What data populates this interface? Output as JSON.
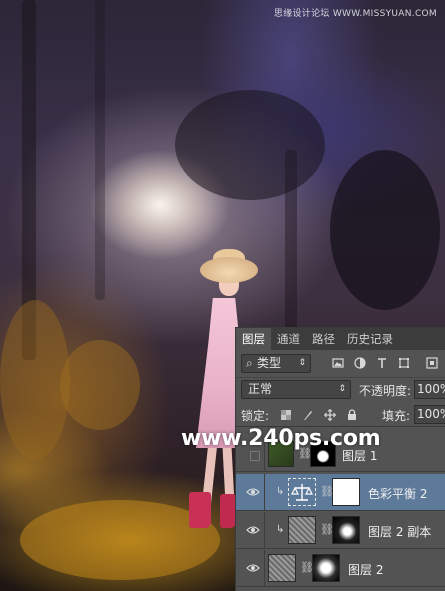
{
  "watermarks": {
    "top_right": "思缘设计论坛 WWW.MISSYUAN.COM",
    "center": "www.240ps.com"
  },
  "layers_panel": {
    "tabs": [
      {
        "label": "图层",
        "active": true
      },
      {
        "label": "通道",
        "active": false
      },
      {
        "label": "路径",
        "active": false
      },
      {
        "label": "历史记录",
        "active": false
      }
    ],
    "filter": {
      "label": "类型",
      "icons": [
        "image-filter-icon",
        "adjustment-filter-icon",
        "type-filter-icon",
        "shape-filter-icon",
        "smart-object-filter-icon"
      ]
    },
    "blend_mode": "正常",
    "opacity_label": "不透明度:",
    "opacity_value": "100%",
    "lock_label": "锁定:",
    "lock_icons": [
      "lock-transparent-icon",
      "lock-paint-icon",
      "lock-position-icon",
      "lock-all-icon"
    ],
    "fill_label": "填充:",
    "fill_value": "100%",
    "layers": [
      {
        "name": "图层 1",
        "visible": false,
        "clipped": false,
        "selected": false
      },
      {
        "name": "色彩平衡 2",
        "visible": true,
        "clipped": true,
        "selected": true
      },
      {
        "name": "图层 2 副本",
        "visible": true,
        "clipped": true,
        "selected": false
      },
      {
        "name": "图层 2",
        "visible": true,
        "clipped": false,
        "selected": false
      }
    ]
  },
  "colors": {
    "panel_bg": "#535353",
    "panel_tabbar": "#3c3c3c",
    "selected_layer": "#5e7a9a"
  }
}
